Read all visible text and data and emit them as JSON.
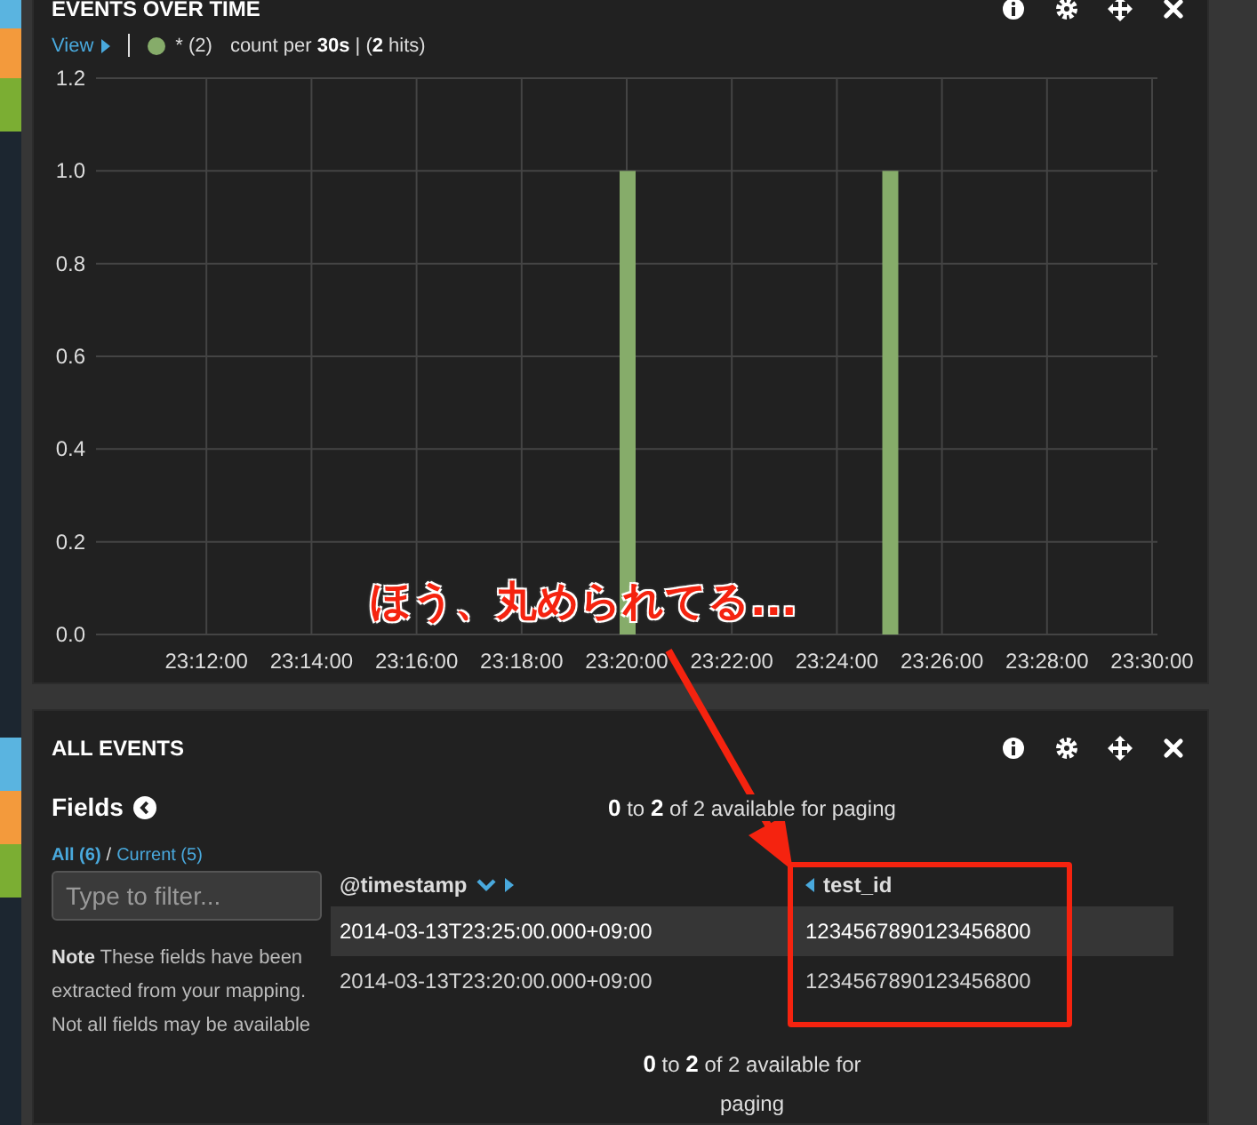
{
  "events_panel": {
    "title": "EVENTS OVER TIME",
    "legend": {
      "view_link": "View",
      "summary": "count per **30s** | (**2** hits)"
    },
    "chart_data": {
      "type": "bar",
      "categories": [
        null,
        null,
        null,
        null,
        "23:12:00",
        null,
        null,
        null,
        "23:14:00",
        null,
        null,
        null,
        "23:16:00",
        null,
        null,
        null,
        "23:18:00",
        null,
        null,
        null,
        "23:20:00",
        null,
        null,
        null,
        "23:22:00",
        null,
        null,
        null,
        "23:24:00",
        null,
        null,
        null,
        "23:26:00",
        null,
        null,
        null,
        "23:28:00",
        null,
        null,
        null,
        "23:30:00"
      ],
      "series": [
        {
          "name": "* (2)",
          "color": "#86ac6a",
          "values": [
            0,
            0,
            0,
            0,
            0,
            0,
            0,
            0,
            0,
            0,
            0,
            0,
            0,
            0,
            0,
            0,
            0,
            0,
            0,
            0,
            1,
            0,
            0,
            0,
            0,
            0,
            0,
            0,
            0,
            0,
            1,
            0,
            0,
            0,
            0,
            0,
            0,
            0,
            0,
            0,
            0
          ]
        }
      ],
      "ylim": [
        0,
        1.2
      ],
      "grid": true,
      "yticks": [
        {
          "value": 0,
          "label": "0.0"
        },
        {
          "value": 0.2,
          "label": "0.2"
        },
        {
          "value": 0.4,
          "label": "0.4"
        },
        {
          "value": 0.6,
          "label": "0.6"
        },
        {
          "value": 0.8,
          "label": "0.8"
        },
        {
          "value": 1,
          "label": "1.0"
        },
        {
          "value": 1.2,
          "label": "1.2"
        }
      ]
    }
  },
  "all_events_panel": {
    "title": "ALL EVENTS",
    "fields_heading": "Fields",
    "field_tabs": [
      {
        "label": "All (6)",
        "selected": true
      },
      {
        "label": "Current (5)",
        "selected": false
      }
    ],
    "field_tab_separator": "/",
    "filter": {
      "placeholder": "Type to filter..."
    },
    "note": "**Note** These fields have been extracted from your mapping.",
    "note_2": "Not all fields may be available",
    "paging_top": "**0** to **2** of 2 available for paging",
    "table": {
      "columns": [
        {
          "label": "@timestamp",
          "sort_icon": true,
          "move_left": false,
          "move_right": true
        },
        {
          "label": "test_id",
          "sort_icon": false,
          "move_left": true,
          "move_right": false
        }
      ],
      "rows": [
        {
          "cells": [
            "2014-03-13T23:25:00.000+09:00",
            "1234567890123456800"
          ],
          "highlighted": true
        },
        {
          "cells": [
            "2014-03-13T23:20:00.000+09:00",
            "1234567890123456800"
          ],
          "highlighted": false
        }
      ]
    },
    "paging_bottom": "**0** to **2** of 2 available for paging"
  },
  "annotation": {
    "text": "ほう、丸められてる..."
  }
}
